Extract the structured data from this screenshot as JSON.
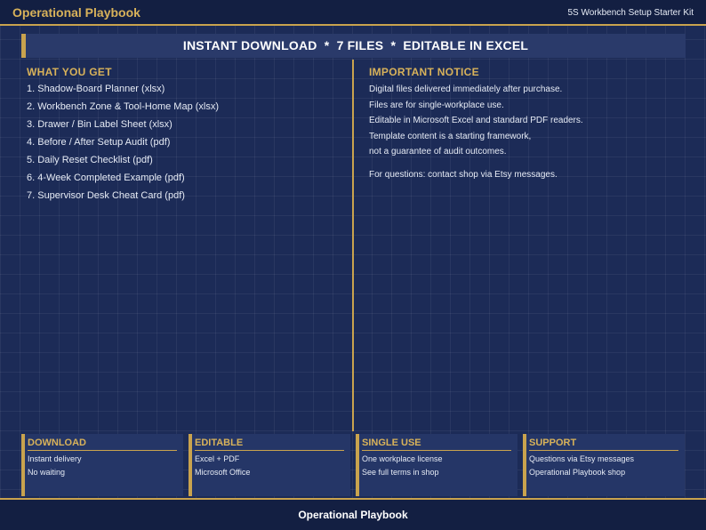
{
  "header": {
    "brand": "Operational Playbook",
    "kit_name": "5S Workbench Setup Starter Kit"
  },
  "banner": {
    "text": "INSTANT DOWNLOAD  *  7 FILES  *  EDITABLE IN EXCEL"
  },
  "what_you_get": {
    "title": "WHAT YOU GET",
    "items": [
      "1. Shadow-Board Planner (xlsx)",
      "2. Workbench Zone & Tool-Home Map (xlsx)",
      "3. Drawer / Bin Label Sheet (xlsx)",
      "4. Before / After Setup Audit (pdf)",
      "5. Daily Reset Checklist (pdf)",
      "6. 4-Week Completed Example (pdf)",
      "7. Supervisor Desk Cheat Card (pdf)"
    ]
  },
  "notice": {
    "title": "IMPORTANT NOTICE",
    "lines": [
      "Digital files delivered immediately after purchase.",
      "Files are for single-workplace use.",
      "Editable in Microsoft Excel and standard PDF readers.",
      "Template content is a starting framework,",
      "not a guarantee of audit outcomes.",
      "For questions: contact shop via Etsy messages."
    ]
  },
  "cards": [
    {
      "title": "DOWNLOAD",
      "lines": [
        "Instant delivery",
        "No waiting"
      ]
    },
    {
      "title": "EDITABLE",
      "lines": [
        "Excel + PDF",
        "Microsoft Office"
      ]
    },
    {
      "title": "SINGLE USE",
      "lines": [
        "One workplace license",
        "See full terms in shop"
      ]
    },
    {
      "title": "SUPPORT",
      "lines": [
        "Questions via Etsy messages",
        "Operational Playbook shop"
      ]
    }
  ],
  "footer": {
    "text": "Operational Playbook"
  },
  "colors": {
    "background": "#1c2b57",
    "accent_gold": "#c9a34e",
    "heading_gold": "#d8b25a",
    "bar_dark": "#131f42"
  }
}
